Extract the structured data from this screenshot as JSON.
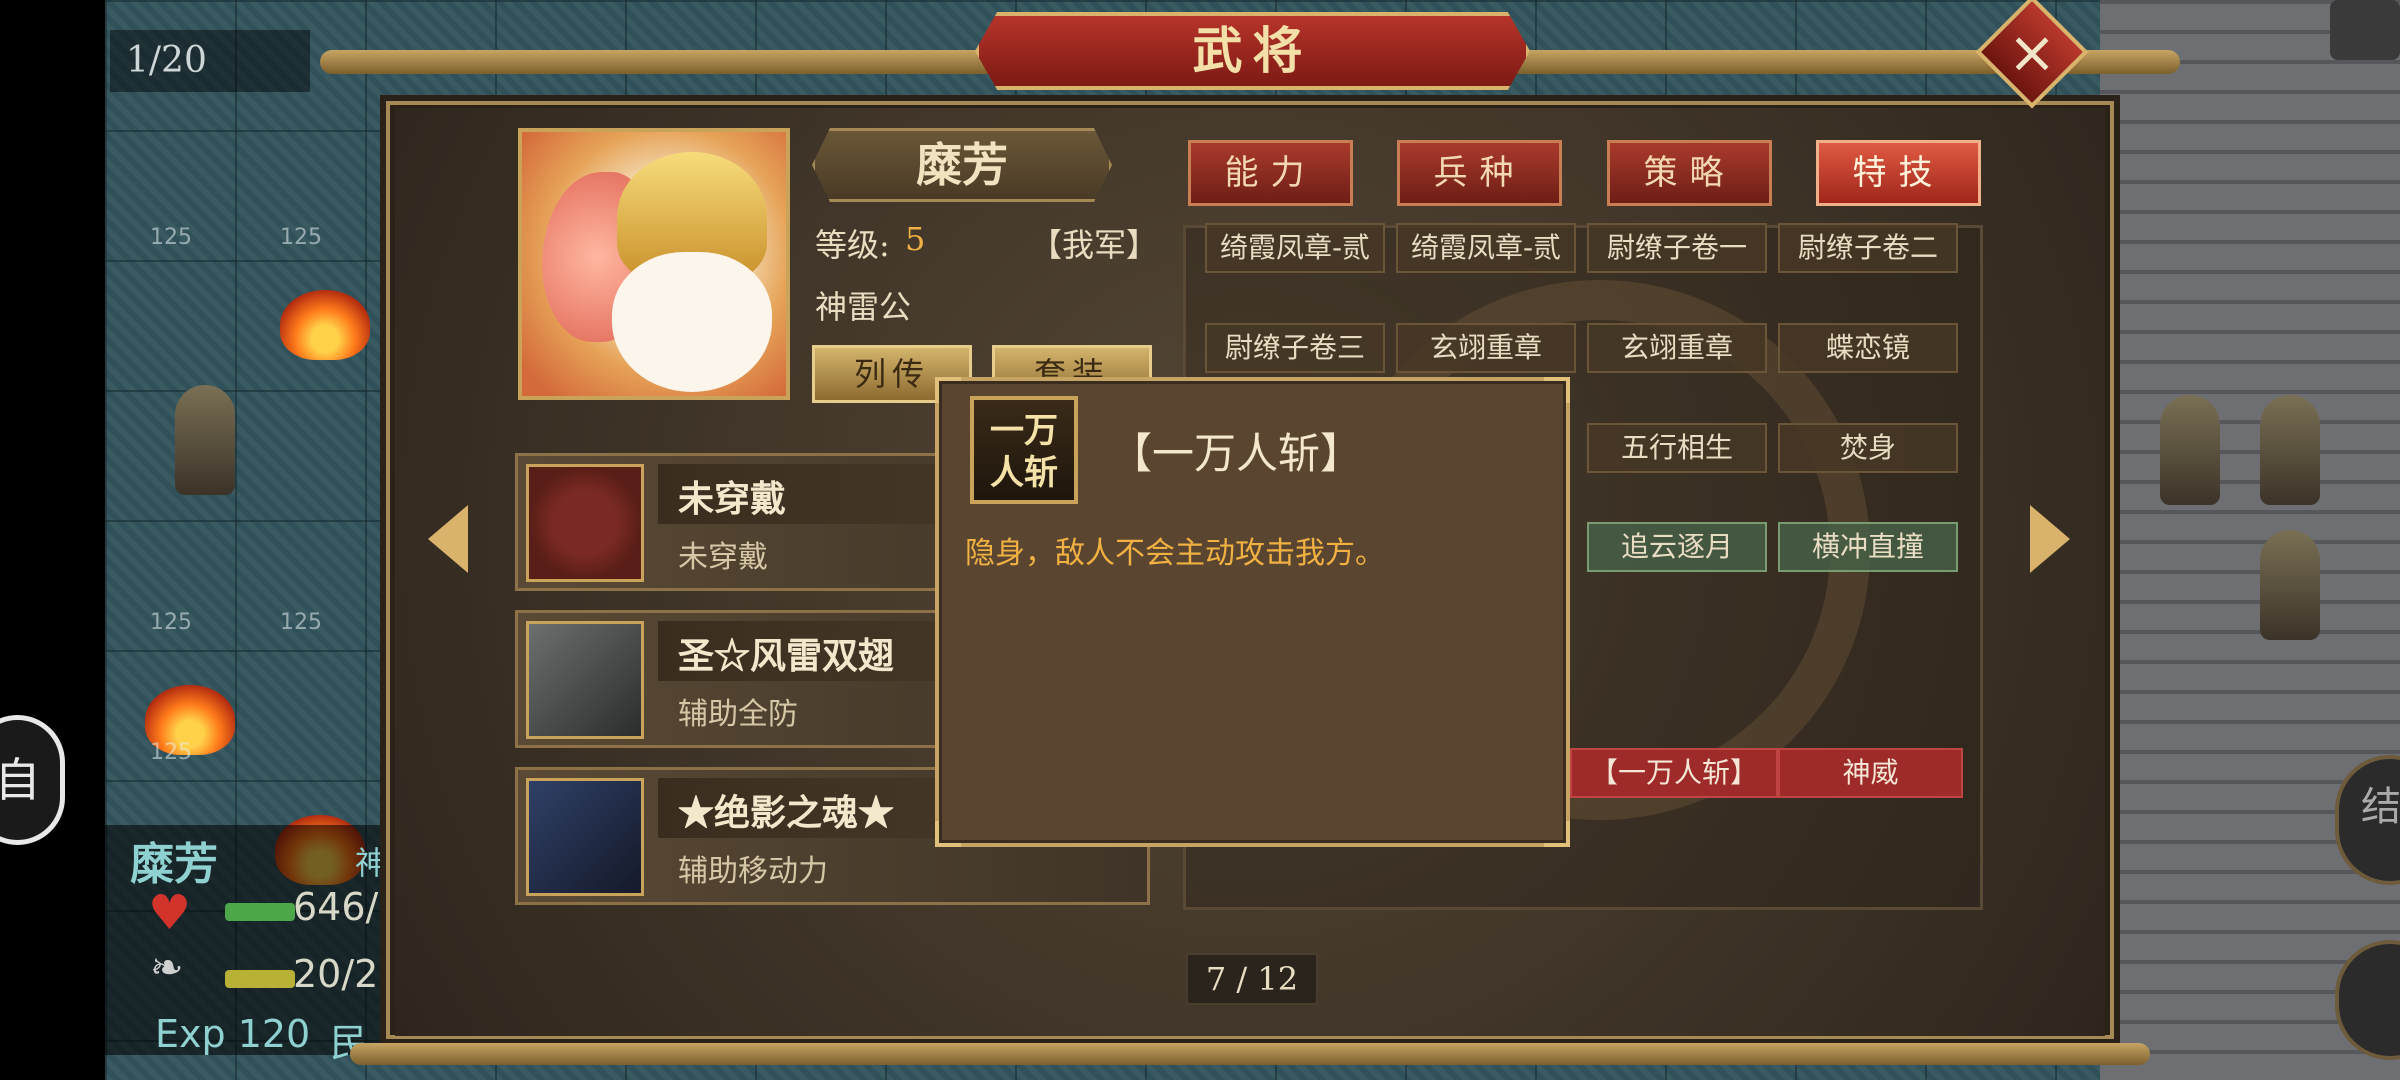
{
  "hud": {
    "turn_counter": "1/20",
    "unit_name": "糜芳",
    "unit_name_extra": "神",
    "hp_text": "646/",
    "mp_text": "20/2",
    "exp_text": "Exp 120",
    "exp_suffix": "民",
    "edge_badge": "自",
    "end_turn_label": "结\n回",
    "tile_value": "125"
  },
  "dialog": {
    "title": "武将",
    "close_label": "×"
  },
  "general": {
    "name": "糜芳",
    "level_label": "等级:",
    "level_value": "5",
    "faction": "【我军】",
    "title": "神雷公",
    "biography_button": "列传",
    "set_button": "套装"
  },
  "equipment": [
    {
      "name": "未穿戴",
      "desc": "未穿戴"
    },
    {
      "name": "圣☆风雷双翅",
      "desc": "辅助全防"
    },
    {
      "name": "★绝影之魂★",
      "desc": "辅助移动力"
    }
  ],
  "tabs": [
    {
      "label": "能力",
      "active": false
    },
    {
      "label": "兵种",
      "active": false
    },
    {
      "label": "策略",
      "active": false
    },
    {
      "label": "特技",
      "active": true
    }
  ],
  "skills": [
    {
      "label": "绮霞凤章-贰",
      "style": "normal"
    },
    {
      "label": "绮霞凤章-贰",
      "style": "normal"
    },
    {
      "label": "尉缭子卷一",
      "style": "normal"
    },
    {
      "label": "尉缭子卷二",
      "style": "normal"
    },
    {
      "label": "尉缭子卷三",
      "style": "normal"
    },
    {
      "label": "玄翊重章",
      "style": "normal"
    },
    {
      "label": "玄翊重章",
      "style": "normal"
    },
    {
      "label": "蝶恋镜",
      "style": "normal"
    },
    {
      "label": "五行相生",
      "style": "normal"
    },
    {
      "label": "焚身",
      "style": "normal"
    },
    {
      "label": "追云逐月",
      "style": "green"
    },
    {
      "label": "横冲直撞",
      "style": "green"
    },
    {
      "label": "【一万人斩】",
      "style": "red"
    },
    {
      "label": "神威",
      "style": "red"
    }
  ],
  "pager": "7 / 12",
  "popup": {
    "icon_text_line1": "一万",
    "icon_text_line2": "人斩",
    "title": "【一万人斩】",
    "description": "隐身，敌人不会主动攻击我方。"
  },
  "colors": {
    "accent_gold": "#c7a463",
    "tab_red": "#a93a2c",
    "highlight_orange": "#f1b042"
  }
}
